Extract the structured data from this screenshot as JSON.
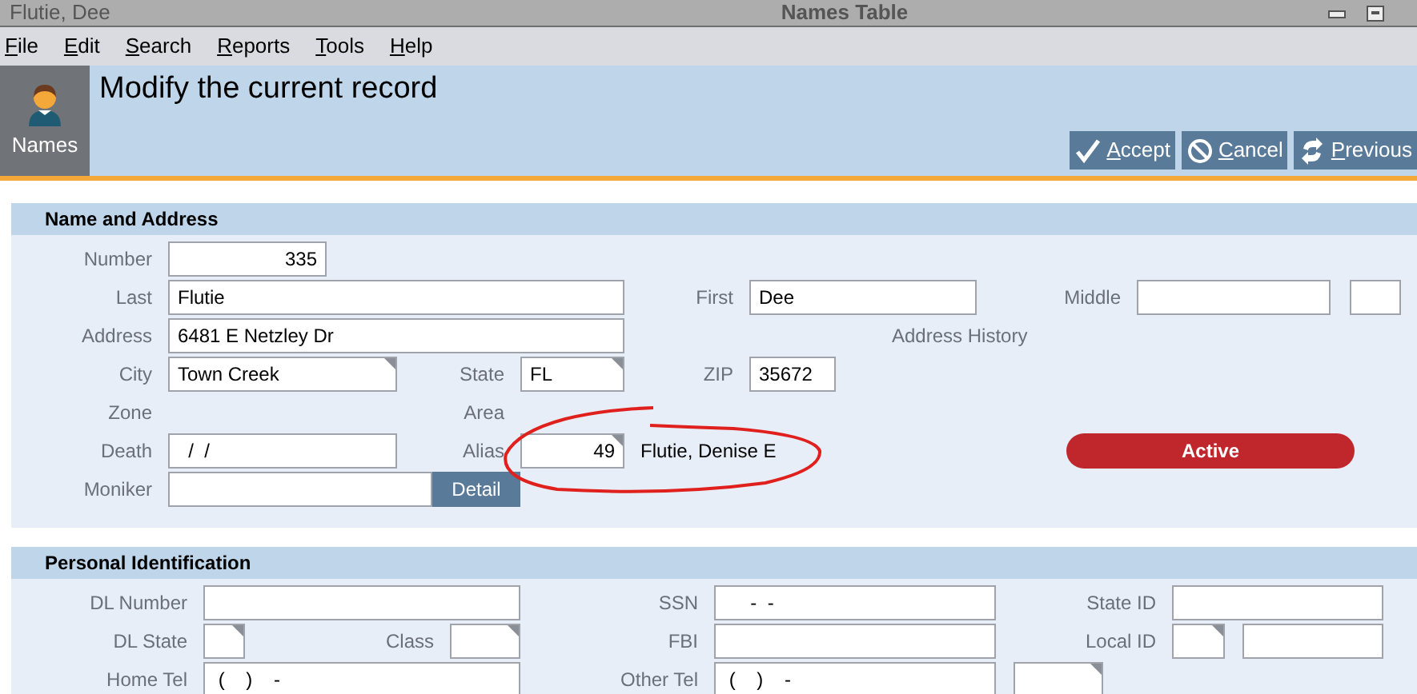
{
  "window": {
    "record": "Flutie, Dee",
    "title": "Names Table"
  },
  "menu": [
    {
      "label": "File"
    },
    {
      "label": "Edit"
    },
    {
      "label": "Search"
    },
    {
      "label": "Reports"
    },
    {
      "label": "Tools"
    },
    {
      "label": "Help"
    }
  ],
  "module": {
    "label": "Names"
  },
  "header": {
    "title": "Modify the current record"
  },
  "actions": [
    {
      "kind": "accept",
      "label": "Accept"
    },
    {
      "kind": "cancel",
      "label": "Cancel"
    },
    {
      "kind": "previous",
      "label": "Previous"
    }
  ],
  "name_and_address": {
    "title": "Name and Address",
    "fields": [
      {
        "label": "Number",
        "value": "335",
        "kind": "number"
      },
      {
        "label": "Last",
        "value": "Flutie",
        "kind": "text"
      },
      {
        "label": "First",
        "value": "Dee",
        "kind": "text"
      },
      {
        "label": "Middle",
        "kind": "text"
      },
      {
        "kind": "text"
      },
      {
        "label": "Address",
        "value": "6481 E Netzley Dr",
        "kind": "text"
      },
      {
        "label": "City",
        "value": "Town Creek",
        "kind": "picker"
      },
      {
        "label": "State",
        "value": "FL",
        "kind": "picker"
      },
      {
        "label": "ZIP",
        "value": "35672",
        "kind": "text"
      },
      {
        "label": "Death",
        "value": "  /  /",
        "kind": "text"
      },
      {
        "label": "Alias",
        "value": "49",
        "kind": "number_picker"
      },
      {
        "label": "Moniker",
        "kind": "text"
      }
    ],
    "address_history": "Address History",
    "zone_label": "Zone",
    "area_label": "Area",
    "alias_name": "Flutie, Denise E",
    "status": "Active",
    "detail_button": "Detail"
  },
  "personal_identification": {
    "title": "Personal Identification",
    "fields": [
      {
        "label": "DL Number",
        "kind": "text"
      },
      {
        "label": "SSN",
        "value": "     -  -",
        "kind": "text"
      },
      {
        "label": "State ID",
        "kind": "text"
      },
      {
        "label": "DL State",
        "kind": "picker"
      },
      {
        "label": "Class",
        "kind": "picker"
      },
      {
        "label": "FBI",
        "kind": "text"
      },
      {
        "label": "Local ID",
        "kind": "picker"
      },
      {
        "kind": "text"
      },
      {
        "label": "Home Tel",
        "value": " (    )    -",
        "kind": "text"
      },
      {
        "label": "Other Tel",
        "value": " (    )    -",
        "kind": "text"
      },
      {
        "kind": "picker"
      }
    ]
  }
}
